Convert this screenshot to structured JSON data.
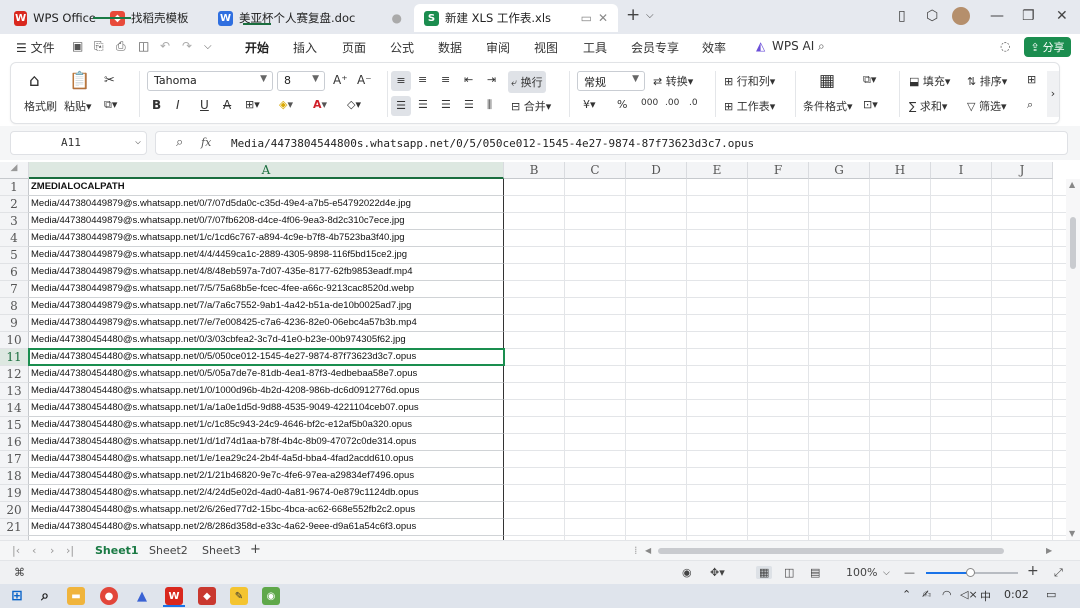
{
  "tabs": [
    {
      "label": "WPS Office",
      "icon": "wps-logo-icon",
      "color": "#d9281e"
    },
    {
      "label": "找稻壳模板",
      "icon": "docer-icon",
      "color": "#e84a3a"
    },
    {
      "label": "美亚杯个人赛复盘.doc",
      "icon": "word-doc-icon",
      "color": "#2f6fe0"
    },
    {
      "label": "新建 XLS 工作表.xls",
      "icon": "spreadsheet-icon",
      "color": "#1b8d4f"
    }
  ],
  "menu": {
    "file": "文件",
    "items": [
      "开始",
      "插入",
      "页面",
      "公式",
      "数据",
      "审阅",
      "视图",
      "工具",
      "会员专享",
      "效率"
    ],
    "wps_ai": "WPS AI",
    "share": "分享"
  },
  "ribbon": {
    "format_painter": "格式刷",
    "paste": "粘贴",
    "font_name": "Tahoma",
    "font_size": "8",
    "wrap": "换行",
    "number_format": "常规",
    "convert": "转换",
    "rows_cols": "行和列",
    "merge": "合并",
    "worksheet": "工作表",
    "conditional_format": "条件格式",
    "fill": "填充",
    "sort": "排序",
    "sum": "求和",
    "filter": "筛选"
  },
  "formula_bar": {
    "name_box": "A11",
    "fx": "fx",
    "content": "Media/4473804544800s.whatsapp.net/0/5/050ce012-1545-4e27-9874-87f73623d3c7.opus"
  },
  "columns": [
    "A",
    "B",
    "C",
    "D",
    "E",
    "F",
    "G",
    "H",
    "I",
    "J"
  ],
  "rows": [
    {
      "n": "1",
      "a": "ZMEDIALOCALPATH"
    },
    {
      "n": "2",
      "a": "Media/447380449879@s.whatsapp.net/0/7/07d5da0c-c35d-49e4-a7b5-e54792022d4e.jpg"
    },
    {
      "n": "3",
      "a": "Media/447380449879@s.whatsapp.net/0/7/07fb6208-d4ce-4f06-9ea3-8d2c310c7ece.jpg"
    },
    {
      "n": "4",
      "a": "Media/447380449879@s.whatsapp.net/1/c/1cd6c767-a894-4c9e-b7f8-4b7523ba3f40.jpg"
    },
    {
      "n": "5",
      "a": "Media/447380449879@s.whatsapp.net/4/4/4459ca1c-2889-4305-9898-116f5bd15ce2.jpg"
    },
    {
      "n": "6",
      "a": "Media/447380449879@s.whatsapp.net/4/8/48eb597a-7d07-435e-8177-62fb9853eadf.mp4"
    },
    {
      "n": "7",
      "a": "Media/447380449879@s.whatsapp.net/7/5/75a68b5e-fcec-4fee-a66c-9213cac8520d.webp"
    },
    {
      "n": "8",
      "a": "Media/447380449879@s.whatsapp.net/7/a/7a6c7552-9ab1-4a42-b51a-de10b0025ad7.jpg"
    },
    {
      "n": "9",
      "a": "Media/447380449879@s.whatsapp.net/7/e/7e008425-c7a6-4236-82e0-06ebc4a57b3b.mp4"
    },
    {
      "n": "10",
      "a": "Media/447380454480@s.whatsapp.net/0/3/03cbfea2-3c7d-41e0-b23e-00b974305f62.jpg"
    },
    {
      "n": "11",
      "a": "Media/447380454480@s.whatsapp.net/0/5/050ce012-1545-4e27-9874-87f73623d3c7.opus"
    },
    {
      "n": "12",
      "a": "Media/447380454480@s.whatsapp.net/0/5/05a7de7e-81db-4ea1-87f3-4edbebaa58e7.opus"
    },
    {
      "n": "13",
      "a": "Media/447380454480@s.whatsapp.net/1/0/1000d96b-4b2d-4208-986b-dc6d0912776d.opus"
    },
    {
      "n": "14",
      "a": "Media/447380454480@s.whatsapp.net/1/a/1a0e1d5d-9d88-4535-9049-4221104ceb07.opus"
    },
    {
      "n": "15",
      "a": "Media/447380454480@s.whatsapp.net/1/c/1c85c943-24c9-4646-bf2c-e12af5b0a320.opus"
    },
    {
      "n": "16",
      "a": "Media/447380454480@s.whatsapp.net/1/d/1d74d1aa-b78f-4b4c-8b09-47072c0de314.opus"
    },
    {
      "n": "17",
      "a": "Media/447380454480@s.whatsapp.net/1/e/1ea29c24-2b4f-4a5d-bba4-4fad2acdd610.opus"
    },
    {
      "n": "18",
      "a": "Media/447380454480@s.whatsapp.net/2/1/21b46820-9e7c-4fe6-97ea-a29834ef7496.opus"
    },
    {
      "n": "19",
      "a": "Media/447380454480@s.whatsapp.net/2/4/24d5e02d-4ad0-4a81-9674-0e879c1124db.opus"
    },
    {
      "n": "20",
      "a": "Media/447380454480@s.whatsapp.net/2/6/26ed77d2-15bc-4bca-ac62-668e552fb2c2.opus"
    },
    {
      "n": "21",
      "a": "Media/447380454480@s.whatsapp.net/2/8/286d358d-e33c-4a62-9eee-d9a61a54c6f3.opus"
    }
  ],
  "sheets": [
    "Sheet1",
    "Sheet2",
    "Sheet3"
  ],
  "status": {
    "zoom": "100%"
  },
  "taskbar": {
    "lang": "中",
    "time": "0:02"
  }
}
